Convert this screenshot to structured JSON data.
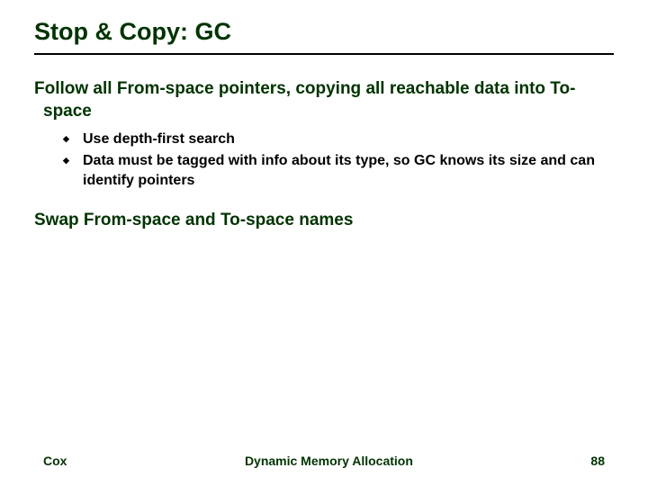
{
  "slide": {
    "title": "Stop & Copy: GC",
    "points": [
      {
        "text": "Follow all From-space pointers, copying all reachable data into To-space",
        "sub": [
          "Use depth-first search",
          "Data must be tagged with info about its type, so GC knows its size and can identify pointers"
        ]
      },
      {
        "text": "Swap From-space and To-space names",
        "sub": []
      }
    ],
    "footer": {
      "left": "Cox",
      "center": "Dynamic Memory Allocation",
      "right": "88"
    }
  }
}
